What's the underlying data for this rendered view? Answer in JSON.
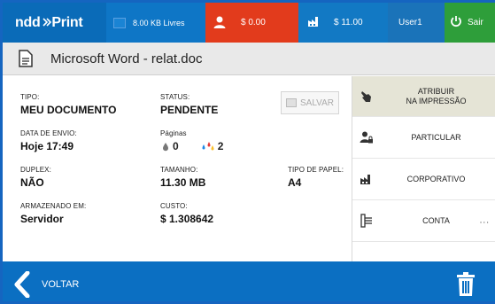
{
  "header": {
    "logo_text": "ndd",
    "logo_print": "Print",
    "storage": "8.00 KB Livres",
    "credit": "$ 0.00",
    "cost": "$ 11.00",
    "user": "User1",
    "logout_label": "Sair",
    "colors": {
      "primary": "#0a6bb8",
      "credit": "#e23b1c",
      "logout": "#2e9e3a"
    }
  },
  "document": {
    "title": "Microsoft Word - relat.doc",
    "icon": "document-icon"
  },
  "details": {
    "tipo": {
      "label": "TIPO:",
      "value": "MEU DOCUMENTO"
    },
    "status": {
      "label": "STATUS:",
      "value": "PENDENTE"
    },
    "save_label": "SALVAR",
    "data_envio": {
      "label": "DATA DE ENVIO:",
      "value": "Hoje 17:49"
    },
    "paginas": {
      "label": "Páginas",
      "mono": "0",
      "color": "2"
    },
    "duplex": {
      "label": "DUPLEX:",
      "value": "NÃO"
    },
    "tamanho": {
      "label": "TAMANHO:",
      "value": "11.30 MB"
    },
    "tipo_papel": {
      "label": "TIPO DE PAPEL:",
      "value": "A4"
    },
    "armazenado": {
      "label": "ARMAZENADO EM:",
      "value": "Servidor"
    },
    "custo": {
      "label": "CUSTO:",
      "value": "$ 1.308642"
    }
  },
  "actions": [
    {
      "label_line1": "ATRIBUIR",
      "label_line2": "NA IMPRESSÃO",
      "icon": "hand-pointer-icon"
    },
    {
      "label_line1": "PARTICULAR",
      "label_line2": "",
      "icon": "user-lock-icon"
    },
    {
      "label_line1": "CORPORATIVO",
      "label_line2": "",
      "icon": "factory-icon"
    },
    {
      "label_line1": "CONTA",
      "label_line2": "",
      "icon": "list-icon",
      "more": "..."
    }
  ],
  "footer": {
    "back_label": "VOLTAR",
    "delete_icon": "trash-icon"
  }
}
